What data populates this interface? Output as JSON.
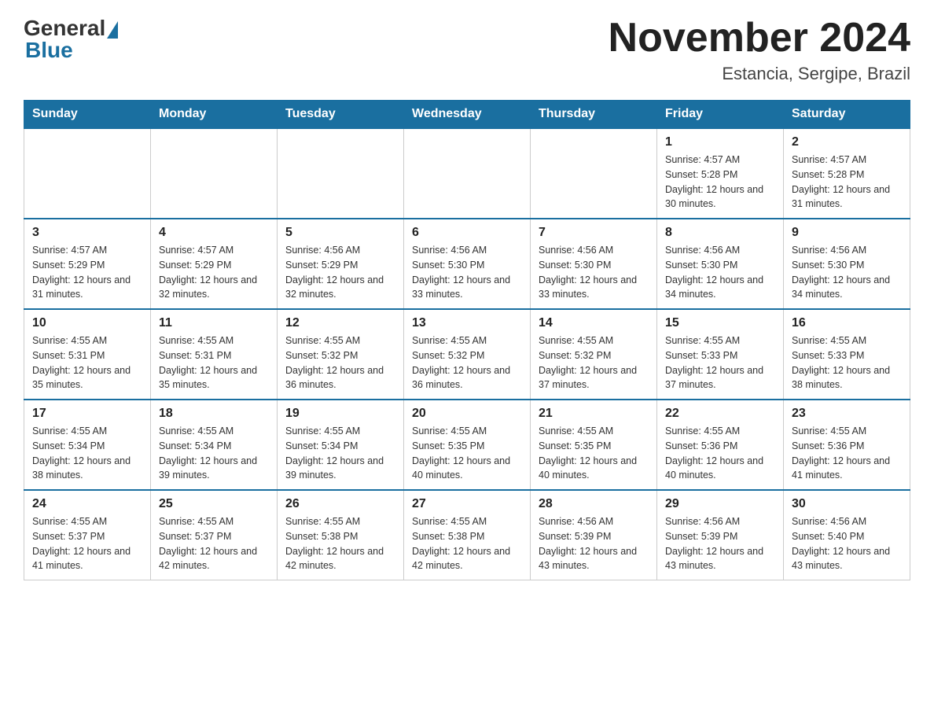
{
  "header": {
    "logo_general": "General",
    "logo_blue": "Blue",
    "month_year": "November 2024",
    "location": "Estancia, Sergipe, Brazil"
  },
  "days_of_week": [
    "Sunday",
    "Monday",
    "Tuesday",
    "Wednesday",
    "Thursday",
    "Friday",
    "Saturday"
  ],
  "weeks": [
    [
      {
        "day": "",
        "info": ""
      },
      {
        "day": "",
        "info": ""
      },
      {
        "day": "",
        "info": ""
      },
      {
        "day": "",
        "info": ""
      },
      {
        "day": "",
        "info": ""
      },
      {
        "day": "1",
        "info": "Sunrise: 4:57 AM\nSunset: 5:28 PM\nDaylight: 12 hours and 30 minutes."
      },
      {
        "day": "2",
        "info": "Sunrise: 4:57 AM\nSunset: 5:28 PM\nDaylight: 12 hours and 31 minutes."
      }
    ],
    [
      {
        "day": "3",
        "info": "Sunrise: 4:57 AM\nSunset: 5:29 PM\nDaylight: 12 hours and 31 minutes."
      },
      {
        "day": "4",
        "info": "Sunrise: 4:57 AM\nSunset: 5:29 PM\nDaylight: 12 hours and 32 minutes."
      },
      {
        "day": "5",
        "info": "Sunrise: 4:56 AM\nSunset: 5:29 PM\nDaylight: 12 hours and 32 minutes."
      },
      {
        "day": "6",
        "info": "Sunrise: 4:56 AM\nSunset: 5:30 PM\nDaylight: 12 hours and 33 minutes."
      },
      {
        "day": "7",
        "info": "Sunrise: 4:56 AM\nSunset: 5:30 PM\nDaylight: 12 hours and 33 minutes."
      },
      {
        "day": "8",
        "info": "Sunrise: 4:56 AM\nSunset: 5:30 PM\nDaylight: 12 hours and 34 minutes."
      },
      {
        "day": "9",
        "info": "Sunrise: 4:56 AM\nSunset: 5:30 PM\nDaylight: 12 hours and 34 minutes."
      }
    ],
    [
      {
        "day": "10",
        "info": "Sunrise: 4:55 AM\nSunset: 5:31 PM\nDaylight: 12 hours and 35 minutes."
      },
      {
        "day": "11",
        "info": "Sunrise: 4:55 AM\nSunset: 5:31 PM\nDaylight: 12 hours and 35 minutes."
      },
      {
        "day": "12",
        "info": "Sunrise: 4:55 AM\nSunset: 5:32 PM\nDaylight: 12 hours and 36 minutes."
      },
      {
        "day": "13",
        "info": "Sunrise: 4:55 AM\nSunset: 5:32 PM\nDaylight: 12 hours and 36 minutes."
      },
      {
        "day": "14",
        "info": "Sunrise: 4:55 AM\nSunset: 5:32 PM\nDaylight: 12 hours and 37 minutes."
      },
      {
        "day": "15",
        "info": "Sunrise: 4:55 AM\nSunset: 5:33 PM\nDaylight: 12 hours and 37 minutes."
      },
      {
        "day": "16",
        "info": "Sunrise: 4:55 AM\nSunset: 5:33 PM\nDaylight: 12 hours and 38 minutes."
      }
    ],
    [
      {
        "day": "17",
        "info": "Sunrise: 4:55 AM\nSunset: 5:34 PM\nDaylight: 12 hours and 38 minutes."
      },
      {
        "day": "18",
        "info": "Sunrise: 4:55 AM\nSunset: 5:34 PM\nDaylight: 12 hours and 39 minutes."
      },
      {
        "day": "19",
        "info": "Sunrise: 4:55 AM\nSunset: 5:34 PM\nDaylight: 12 hours and 39 minutes."
      },
      {
        "day": "20",
        "info": "Sunrise: 4:55 AM\nSunset: 5:35 PM\nDaylight: 12 hours and 40 minutes."
      },
      {
        "day": "21",
        "info": "Sunrise: 4:55 AM\nSunset: 5:35 PM\nDaylight: 12 hours and 40 minutes."
      },
      {
        "day": "22",
        "info": "Sunrise: 4:55 AM\nSunset: 5:36 PM\nDaylight: 12 hours and 40 minutes."
      },
      {
        "day": "23",
        "info": "Sunrise: 4:55 AM\nSunset: 5:36 PM\nDaylight: 12 hours and 41 minutes."
      }
    ],
    [
      {
        "day": "24",
        "info": "Sunrise: 4:55 AM\nSunset: 5:37 PM\nDaylight: 12 hours and 41 minutes."
      },
      {
        "day": "25",
        "info": "Sunrise: 4:55 AM\nSunset: 5:37 PM\nDaylight: 12 hours and 42 minutes."
      },
      {
        "day": "26",
        "info": "Sunrise: 4:55 AM\nSunset: 5:38 PM\nDaylight: 12 hours and 42 minutes."
      },
      {
        "day": "27",
        "info": "Sunrise: 4:55 AM\nSunset: 5:38 PM\nDaylight: 12 hours and 42 minutes."
      },
      {
        "day": "28",
        "info": "Sunrise: 4:56 AM\nSunset: 5:39 PM\nDaylight: 12 hours and 43 minutes."
      },
      {
        "day": "29",
        "info": "Sunrise: 4:56 AM\nSunset: 5:39 PM\nDaylight: 12 hours and 43 minutes."
      },
      {
        "day": "30",
        "info": "Sunrise: 4:56 AM\nSunset: 5:40 PM\nDaylight: 12 hours and 43 minutes."
      }
    ]
  ]
}
